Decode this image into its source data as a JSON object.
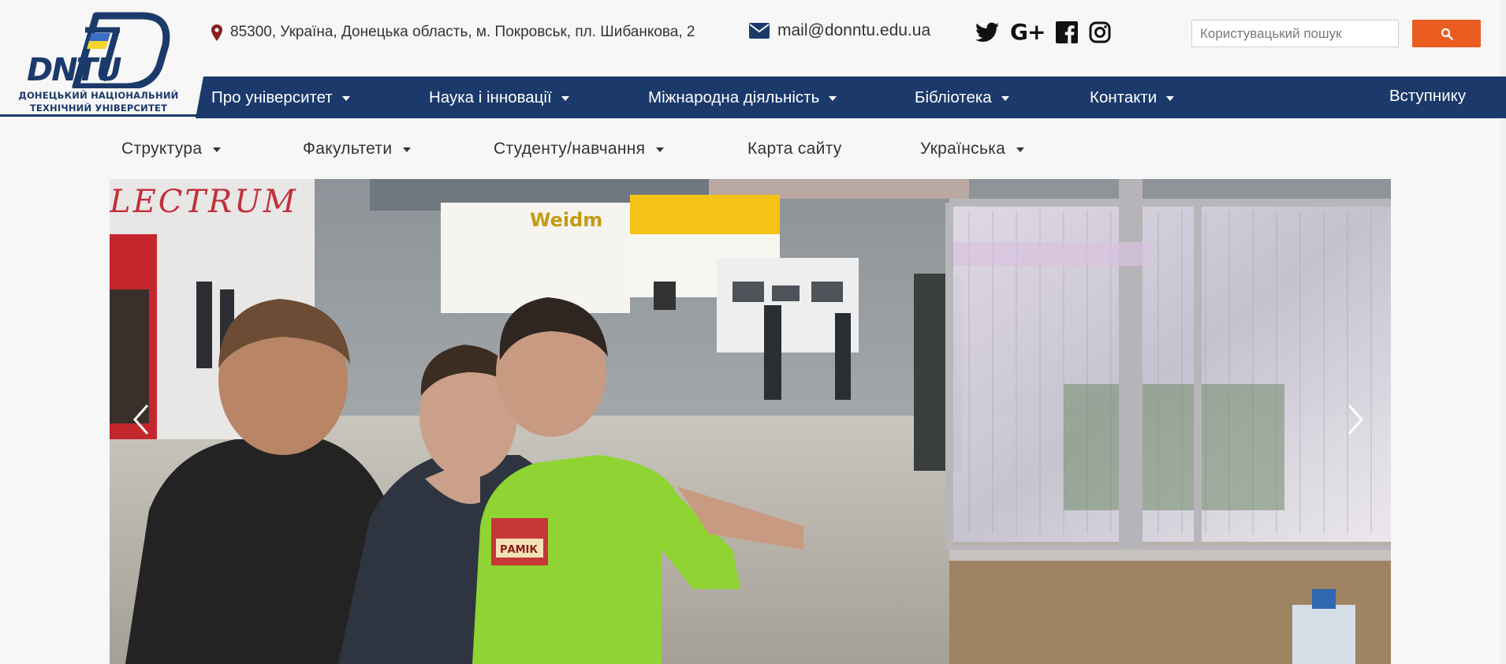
{
  "brand": {
    "logo_text": "DNTU",
    "name_line1": "ДОНЕЦЬКИЙ НАЦІОНАЛЬНИЙ",
    "name_line2": "ТЕХНІЧНИЙ УНІВЕРСИТЕТ",
    "primary_color": "#1b3a6b",
    "accent_color": "#ea5c20"
  },
  "contact": {
    "address": "85300, Україна, Донецька область, м. Покровськ, пл. Шибанкова, 2",
    "email": "mail@donntu.edu.ua"
  },
  "social": [
    {
      "name": "twitter-icon"
    },
    {
      "name": "google-plus-icon",
      "label": "G+"
    },
    {
      "name": "facebook-icon"
    },
    {
      "name": "instagram-icon"
    }
  ],
  "search": {
    "placeholder": "Користувацький пошук",
    "button_icon": "search-icon"
  },
  "main_nav": [
    {
      "label": "Про університет",
      "has_dropdown": true
    },
    {
      "label": "Наука і інновації",
      "has_dropdown": true
    },
    {
      "label": "Міжнародна діяльність",
      "has_dropdown": true
    },
    {
      "label": "Бібліотека",
      "has_dropdown": true
    },
    {
      "label": "Контакти",
      "has_dropdown": true
    },
    {
      "label": "Вступнику",
      "has_dropdown": false
    }
  ],
  "sub_nav": [
    {
      "label": "Структура",
      "has_dropdown": true
    },
    {
      "label": "Факультети",
      "has_dropdown": true
    },
    {
      "label": "Студенту/навчання",
      "has_dropdown": true
    },
    {
      "label": "Карта сайту",
      "has_dropdown": false
    },
    {
      "label": "Українська",
      "has_dropdown": true
    }
  ],
  "slider": {
    "photo_signs": {
      "left_banner": "LECTRUM",
      "booth_sign": "Weidm",
      "badge": "РАМІК"
    },
    "prev_icon": "chevron-left-icon",
    "next_icon": "chevron-right-icon"
  }
}
